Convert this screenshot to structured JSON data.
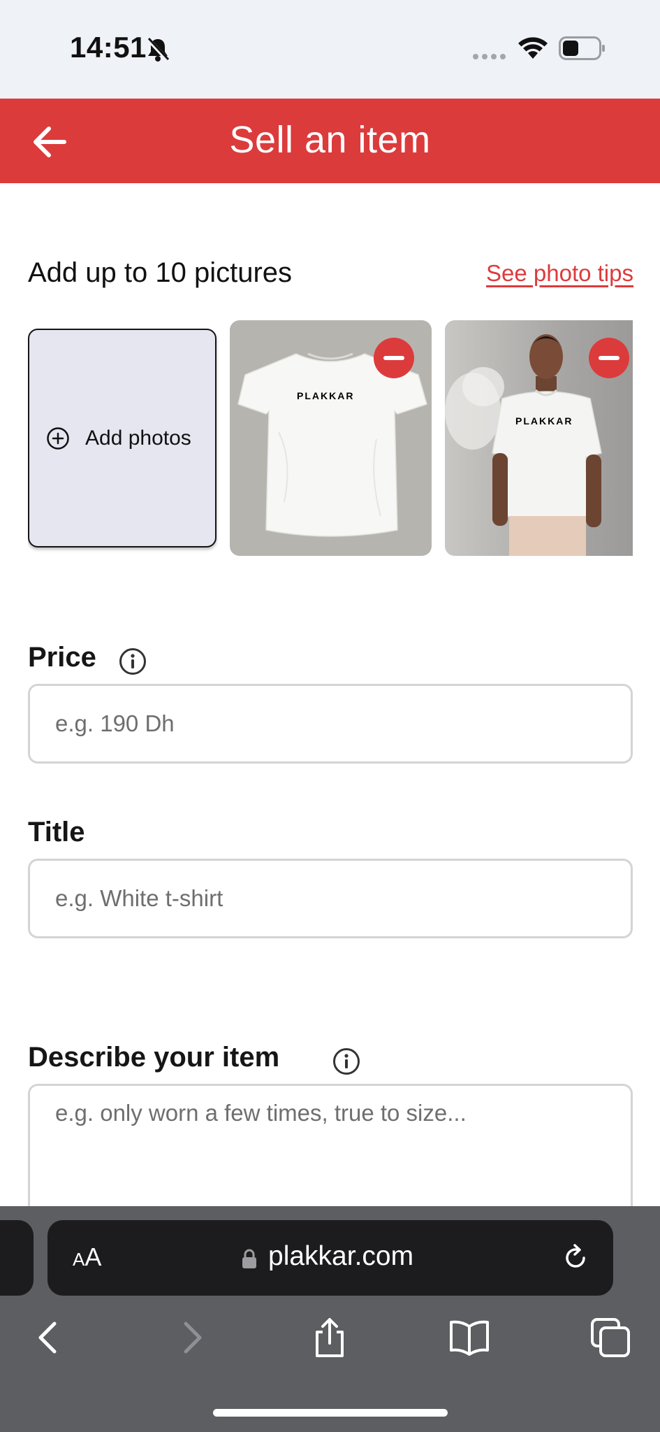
{
  "status_bar": {
    "time": "14:51"
  },
  "header": {
    "title": "Sell an item",
    "back_icon": "arrow-left-icon",
    "color": "#dc3b3c"
  },
  "photos": {
    "heading": "Add up to 10 pictures",
    "tips_link": "See photo tips",
    "add_label": "Add photos",
    "items": [
      {
        "description": "white t-shirt flat lay",
        "print_text": "PLAKKAR"
      },
      {
        "description": "man wearing white t-shirt",
        "print_text": "PLAKKAR"
      }
    ]
  },
  "form": {
    "price": {
      "label": "Price",
      "placeholder": "e.g. 190 Dh"
    },
    "title": {
      "label": "Title",
      "placeholder": "e.g. White t-shirt"
    },
    "description": {
      "label": "Describe your item",
      "placeholder": "e.g. only worn a few times, true to size..."
    }
  },
  "browser": {
    "text_size_small": "A",
    "text_size_large": "A",
    "url": "plakkar.com"
  }
}
